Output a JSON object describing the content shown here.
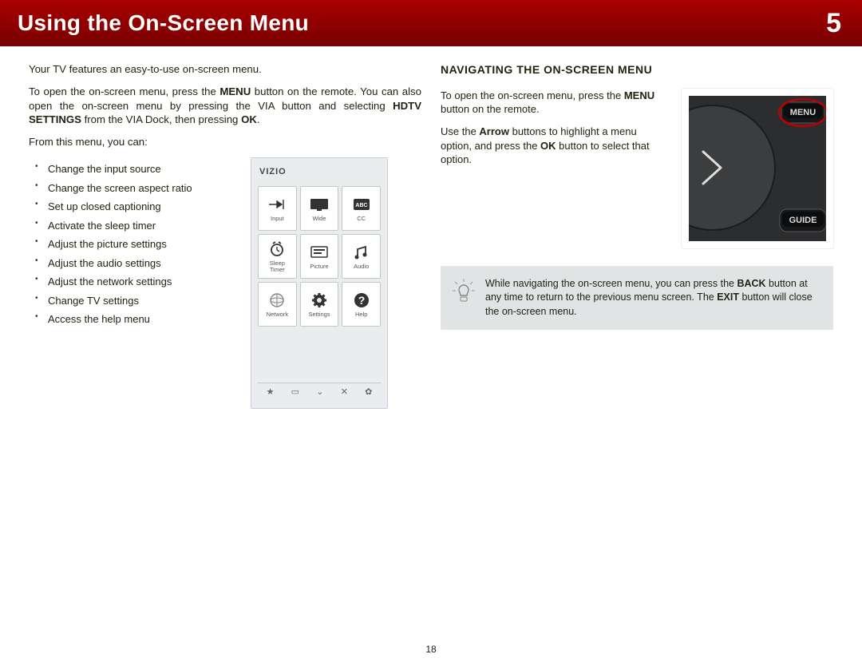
{
  "header": {
    "title": "Using the On-Screen Menu",
    "chapter": "5"
  },
  "left": {
    "intro": "Your TV features an easy-to-use on-screen menu.",
    "open1": "To open the on-screen menu, press the ",
    "open_bold1": "MENU",
    "open2": " button on the remote. You can also open the on-screen menu by pressing the VIA button and selecting ",
    "open_bold2": "HDTV SETTINGS",
    "open3": " from the VIA Dock, then pressing ",
    "open_bold3": "OK",
    "open4": ".",
    "from": "From this menu, you can:",
    "bullets": [
      "Change the input source",
      "Change the screen aspect ratio",
      "Set up closed captioning",
      "Activate the sleep timer",
      "Adjust the picture settings",
      "Adjust the audio settings",
      "Adjust the network settings",
      "Change TV settings",
      "Access the help menu"
    ]
  },
  "vizio": {
    "logo": "VIZIO",
    "cells": [
      {
        "label": "Input"
      },
      {
        "label": "Wide"
      },
      {
        "label": "CC"
      },
      {
        "label": "Sleep\nTimer"
      },
      {
        "label": "Picture"
      },
      {
        "label": "Audio"
      },
      {
        "label": "Network"
      },
      {
        "label": "Settings"
      },
      {
        "label": "Help"
      }
    ],
    "bbar": [
      "★",
      "▭",
      "⌄",
      "✕",
      "✿"
    ]
  },
  "right": {
    "subhead": "NAVIGATING THE ON-SCREEN MENU",
    "p1a": "To open the on-screen menu, press the ",
    "p1b": "MENU",
    "p1c": " button on the remote.",
    "p2a": "Use the ",
    "p2b": "Arrow",
    "p2c": " buttons to highlight a menu option, and press the ",
    "p2d": "OK",
    "p2e": " button to select that option.",
    "remote": {
      "menu_label": "MENU",
      "guide_label": "GUIDE"
    },
    "tip": {
      "t1": "While navigating the on-screen menu, you can press the ",
      "t2": "BACK",
      "t3": " button at any time to return to the previous menu screen. The ",
      "t4": "EXIT",
      "t5": " button will close the on-screen menu."
    }
  },
  "page_number": "18"
}
